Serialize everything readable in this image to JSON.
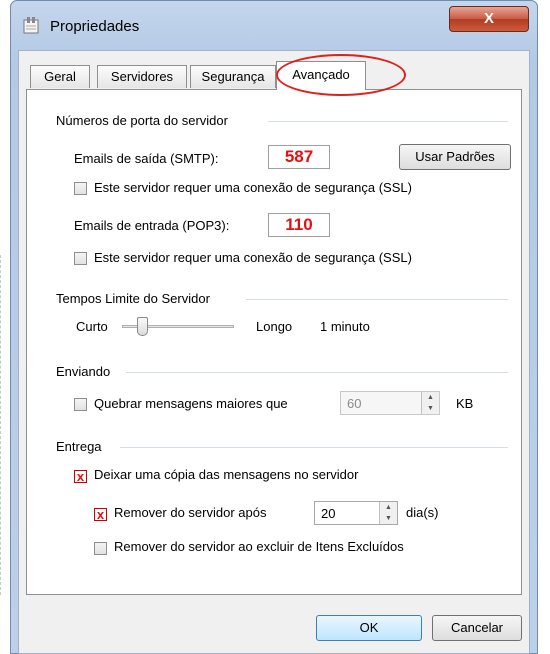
{
  "window": {
    "title": "Propriedades",
    "close_glyph": "X"
  },
  "tabs": [
    {
      "label": "Geral"
    },
    {
      "label": "Servidores"
    },
    {
      "label": "Segurança"
    },
    {
      "label": "Avançado"
    }
  ],
  "active_tab": "Avançado",
  "ports": {
    "heading": "Números de porta do servidor",
    "smtp_label": "Emails de saída (SMTP):",
    "smtp_value": "587",
    "defaults_button": "Usar Padrões",
    "smtp_ssl_label": "Este servidor requer uma conexão de segurança (SSL)",
    "pop3_label": "Emails de entrada (POP3):",
    "pop3_value": "110",
    "pop3_ssl_label": "Este servidor requer uma conexão de segurança (SSL)"
  },
  "timeouts": {
    "heading": "Tempos Limite do Servidor",
    "short_label": "Curto",
    "long_label": "Longo",
    "value_text": "1 minuto",
    "slider_level": 0.15
  },
  "sending": {
    "heading": "Enviando",
    "break_label": "Quebrar mensagens maiores que",
    "break_value": "60",
    "unit": "KB"
  },
  "delivery": {
    "heading": "Entrega",
    "leave_copy_label": "Deixar uma cópia das mensagens no servidor",
    "remove_after_label": "Remover do servidor após",
    "remove_after_value": "20",
    "days_unit": "dia(s)",
    "remove_deleted_label": "Remover do servidor ao excluir de Itens Excluídos",
    "check_glyph": "x"
  },
  "footer": {
    "ok_label": "OK",
    "cancel_label": "Cancelar"
  },
  "colors": {
    "highlight": "#e0201a",
    "port_text": "#e01212"
  }
}
